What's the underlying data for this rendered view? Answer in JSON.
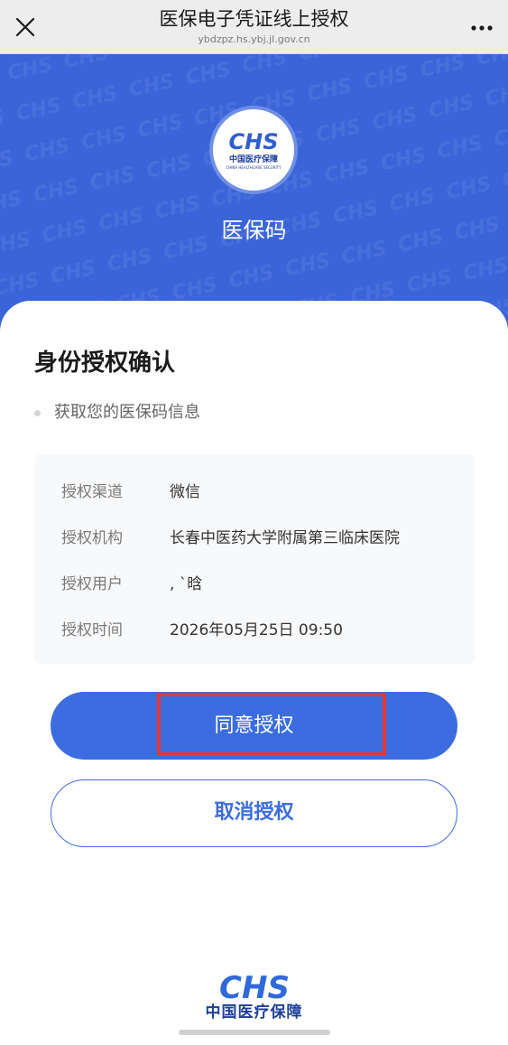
{
  "topbar": {
    "title": "医保电子凭证线上授权",
    "url": "ybdzpz.hs.ybj.jl.gov.cn",
    "close_icon": "close-icon",
    "more_icon": "more-horizontal-icon"
  },
  "hero": {
    "logo_mark": "CHS",
    "logo_text_cn": "中国医疗保障",
    "logo_text_en": "CHINA HEALTHCARE SECURITY",
    "title": "医保码",
    "background_color": "#3a64d8"
  },
  "card": {
    "title": "身份授权确认",
    "bullet": "获取您的医保码信息",
    "rows": [
      {
        "label": "授权渠道",
        "value": "微信"
      },
      {
        "label": "授权机构",
        "value": "长春中医药大学附属第三临床医院"
      },
      {
        "label": "授权用户",
        "value": ", `晗"
      },
      {
        "label": "授权时间",
        "value": "2026年05月25日 09:50"
      }
    ]
  },
  "buttons": {
    "agree": "同意授权",
    "cancel": "取消授权",
    "accent_color": "#3c6de0",
    "highlight_color": "#e53935"
  },
  "footer": {
    "logo_mark": "CHS",
    "logo_text_cn": "中国医疗保障"
  }
}
